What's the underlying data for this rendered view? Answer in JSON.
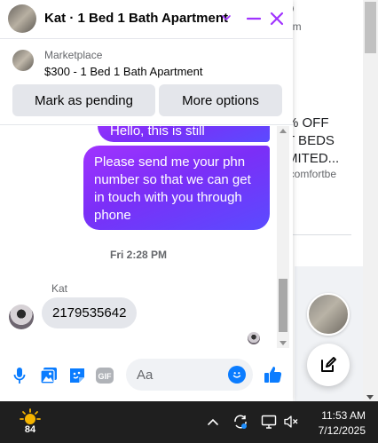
{
  "background_page": {
    "snippet_1": "9",
    "snippet_2": "om",
    "snippet_3": "% OFF",
    "snippet_4": "T BEDS",
    "snippet_5": "MITED...",
    "snippet_6": "lcomfortbe"
  },
  "chat": {
    "header_title": "Kat · 1 Bed 1 Bath Apartment",
    "listing": {
      "source": "Marketplace",
      "title": "$300 - 1 Bed 1 Bath Apartment"
    },
    "buttons": {
      "mark_pending": "Mark as pending",
      "more_options": "More options"
    },
    "messages": {
      "outgoing_1": "Hello, this is still available",
      "outgoing_2": "Please send me your phn number so that we can get in touch with you through phone",
      "timestamp": "Fri 2:28 PM",
      "sender_name": "Kat",
      "incoming_1": "2179535642"
    },
    "composer": {
      "placeholder": "Aa"
    }
  },
  "taskbar": {
    "weather_temp": "84",
    "time": "11:53 AM",
    "date": "7/12/2025"
  },
  "colors": {
    "accent": "#0a7cff",
    "messenger_purple": "#a033ff",
    "messenger_blue": "#5a4bff",
    "header_icon": "#a033ff",
    "taskbar": "#1f1f1f"
  }
}
